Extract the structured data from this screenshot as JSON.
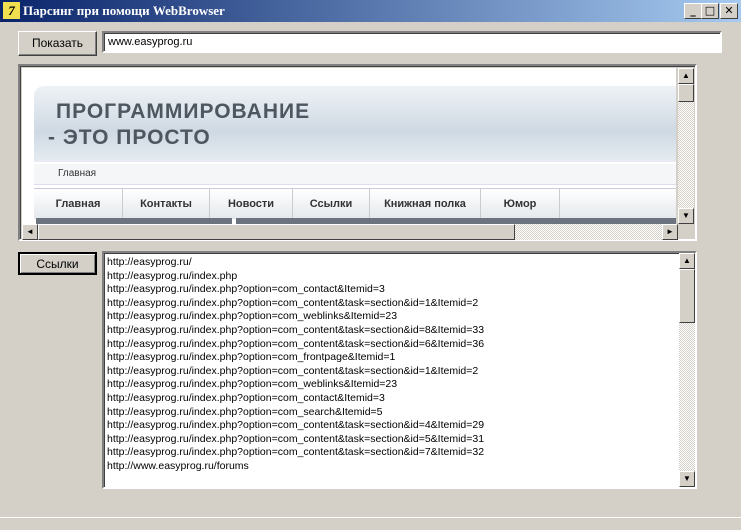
{
  "window": {
    "title": "Парсинг при помощи WebBrowser",
    "icon_char": "7",
    "minimize": "_",
    "maximize": "□",
    "close": "✕"
  },
  "toolbar": {
    "show_button": "Показать",
    "address_value": "www.easyprog.ru"
  },
  "browser": {
    "site_title_line1": "ПРОГРАММИРОВАНИЕ",
    "site_title_line2": "- ЭТО ПРОСТО",
    "breadcrumb": "Главная",
    "menu": [
      "Главная",
      "Контакты",
      "Новости",
      "Ссылки",
      "Книжная полка",
      "Юмор"
    ]
  },
  "links_button": "Ссылки",
  "links": [
    "http://easyprog.ru/",
    "http://easyprog.ru/index.php",
    "http://easyprog.ru/index.php?option=com_contact&Itemid=3",
    "http://easyprog.ru/index.php?option=com_content&task=section&id=1&Itemid=2",
    "http://easyprog.ru/index.php?option=com_weblinks&Itemid=23",
    "http://easyprog.ru/index.php?option=com_content&task=section&id=8&Itemid=33",
    "http://easyprog.ru/index.php?option=com_content&task=section&id=6&Itemid=36",
    "http://easyprog.ru/index.php?option=com_frontpage&Itemid=1",
    "http://easyprog.ru/index.php?option=com_content&task=section&id=1&Itemid=2",
    "http://easyprog.ru/index.php?option=com_weblinks&Itemid=23",
    "http://easyprog.ru/index.php?option=com_contact&Itemid=3",
    "http://easyprog.ru/index.php?option=com_search&Itemid=5",
    "http://easyprog.ru/index.php?option=com_content&task=section&id=4&Itemid=29",
    "http://easyprog.ru/index.php?option=com_content&task=section&id=5&Itemid=31",
    "http://easyprog.ru/index.php?option=com_content&task=section&id=7&Itemid=32",
    "http://www.easyprog.ru/forums"
  ],
  "scroll_glyphs": {
    "up": "▲",
    "down": "▼",
    "left": "◄",
    "right": "►"
  },
  "colors": {
    "titlebar_start": "#0a246a",
    "titlebar_end": "#a6caf0",
    "window_bg": "#d4d0c8"
  }
}
